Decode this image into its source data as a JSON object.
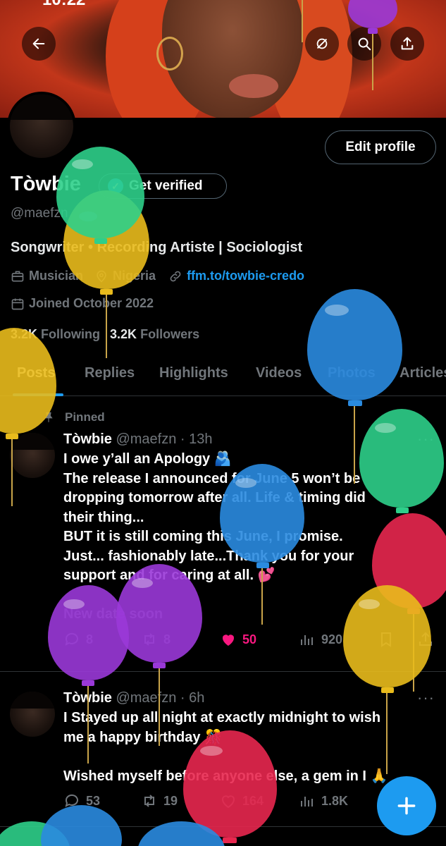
{
  "status": {
    "time": "10:22"
  },
  "header": {
    "back_label": "Back",
    "icons": [
      "back-icon",
      "sync-icon",
      "search-icon",
      "share-icon"
    ]
  },
  "profile": {
    "edit_button": "Edit profile",
    "name": "Tòwbie",
    "verify_label": "Get verified",
    "handle": "@maefzn",
    "bio": "Songwriter • Recording Artiste | Sociologist",
    "category": "Musician",
    "location": "Nigeria",
    "link": "ffm.to/towbie-credo",
    "joined": "Joined October 2022",
    "following_count": "3.2K",
    "following_label": "Following",
    "followers_count": "3.2K",
    "followers_label": "Followers"
  },
  "tabs": [
    "Posts",
    "Replies",
    "Highlights",
    "Videos",
    "Photos",
    "Articles"
  ],
  "active_tab": "Posts",
  "posts": [
    {
      "pinned_label": "Pinned",
      "name": "Tòwbie",
      "handle_time": "@maefzn · 13h",
      "lines": [
        "I owe y’all an Apology 🫂",
        "The release I announced for June 5 won’t be",
        "dropping tomorrow after all. Life & timing did",
        "their thing...",
        "BUT it is still coming this June, I promise.",
        "Just... fashionably late...Thank you for your",
        "support and for caring at all. 💕"
      ],
      "note": "New date soon",
      "replies": "8",
      "reposts": "8",
      "likes": "50",
      "views": "920"
    },
    {
      "name": "Tòwbie",
      "handle_time": "@maefzn · 6h",
      "lines": [
        "I Stayed up all night  at exactly midnight to wish",
        "me a happy birthday 🎊",
        "",
        "Wished myself before anyone else, a gem in I 🙏"
      ],
      "replies": "53",
      "reposts": "19",
      "likes": "164",
      "views": "1.8K"
    }
  ],
  "colors": {
    "accent": "#1d9bf0",
    "like": "#f91880",
    "muted": "#71767b",
    "balloon_green": "#2ecf8a",
    "balloon_yellow": "#e9bb1c",
    "balloon_blue": "#2a8be0",
    "balloon_purple": "#9a38d8",
    "balloon_red": "#e8274f"
  }
}
